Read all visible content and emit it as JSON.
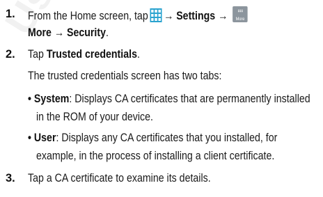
{
  "step1": {
    "number": "1.",
    "text_before_icon": "From the Home screen, tap",
    "apps_icon": "apps-grid-icon",
    "arrow": "→",
    "settings": "Settings",
    "more_icon_label": "More",
    "more": "More",
    "security": "Security",
    "period": "."
  },
  "step2": {
    "number": "2.",
    "tap": "Tap",
    "trusted_credentials": "Trusted credentials",
    "period": ".",
    "intro": "The trusted credentials screen has two tabs:",
    "bullets": [
      {
        "bullet": "•",
        "term": "System",
        "line1": ": Displays CA certificates that are permanently installed",
        "line2": "in the ROM of your device."
      },
      {
        "bullet": "•",
        "term": "User",
        "line1": ": Displays any CA certificates that you installed, for",
        "line2": "example, in the process of installing a client certificate."
      }
    ]
  },
  "step3": {
    "number": "3.",
    "text": "Tap a CA certificate to examine its details."
  },
  "colors": {
    "text": "#1a1a1a",
    "apps_icon": "#2aa3cf",
    "more_icon_bg": "#8c959d"
  }
}
